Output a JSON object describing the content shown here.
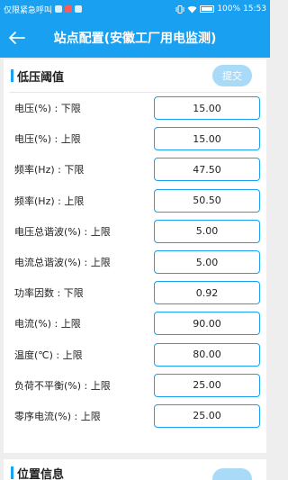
{
  "status": {
    "left_text": "仅限紧急呼叫",
    "battery": "100%",
    "time": "15:53"
  },
  "header": {
    "title": "站点配置(安徽工厂用电监测)"
  },
  "section1": {
    "title": "低压阈值",
    "submit_label": "提交",
    "rows": [
      {
        "label": "电压(%) : 下限",
        "value": "15.00"
      },
      {
        "label": "电压(%) : 上限",
        "value": "15.00"
      },
      {
        "label": "频率(Hz) : 下限",
        "value": "47.50"
      },
      {
        "label": "频率(Hz) : 上限",
        "value": "50.50"
      },
      {
        "label": "电压总谐波(%) : 上限",
        "value": "5.00"
      },
      {
        "label": "电流总谐波(%) : 上限",
        "value": "5.00"
      },
      {
        "label": "功率因数 : 下限",
        "value": "0.92"
      },
      {
        "label": "电流(%) : 上限",
        "value": "90.00"
      },
      {
        "label": "温度(℃) : 上限",
        "value": "80.00"
      },
      {
        "label": "负荷不平衡(%) : 上限",
        "value": "25.00"
      },
      {
        "label": "零序电流(%) : 上限",
        "value": "25.00"
      }
    ]
  },
  "section2": {
    "title": "位置信息"
  },
  "colors": {
    "primary": "#1aa0f0",
    "submit_bg": "#a9daf7",
    "background": "#eeeeee"
  }
}
